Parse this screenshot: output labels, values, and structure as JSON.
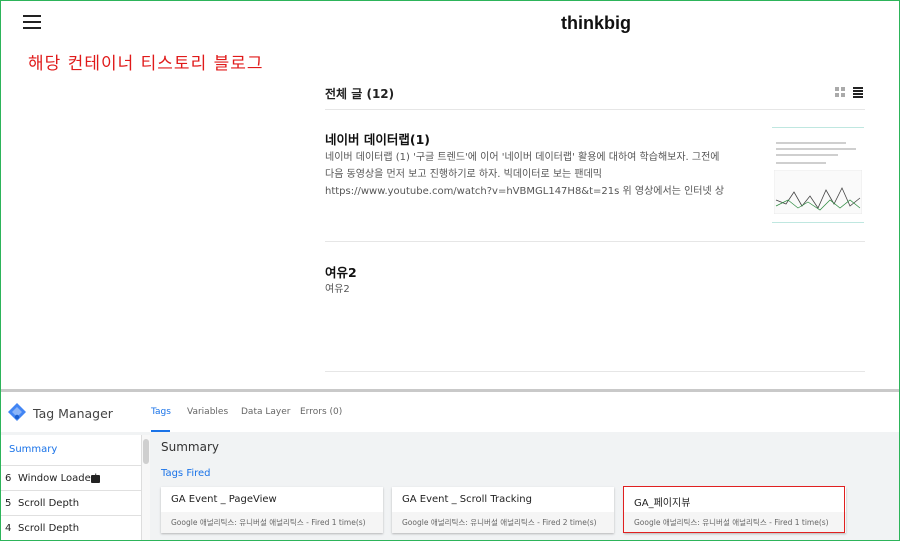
{
  "blog": {
    "site_title": "thinkbig",
    "annotation": "해당 컨테이너 티스토리 블로그",
    "list_header": "전체 글 (12)",
    "posts": [
      {
        "title": "네이버 데이터랩(1)",
        "excerpt": "네이버 데이터랩 (1) '구글 트렌드'에 이어 '네이버 데이터랩' 활용에 대하여 학습해보자. 그전에 다음 동영상을 먼저 보고 진행하기로 하자. 빅데이터로 보는 팬데믹 https://www.youtube.com/watch?v=hVBMGL147H8&t=21s 위 영상에서는 인터넷 상의 '언급량'을 기반으로 이야기를 풀어가고 있으…"
      },
      {
        "title": "여유2",
        "excerpt": "여유2"
      }
    ]
  },
  "gtm": {
    "app_name": "Tag Manager",
    "tabs": [
      "Tags",
      "Variables",
      "Data Layer",
      "Errors (0)"
    ],
    "active_tab": "Tags",
    "left_summary": "Summary",
    "events": [
      {
        "num": "6",
        "name": "Window Loaded"
      },
      {
        "num": "5",
        "name": "Scroll Depth"
      },
      {
        "num": "4",
        "name": "Scroll Depth"
      }
    ],
    "summary_title": "Summary",
    "tags_fired_label": "Tags Fired",
    "tag_cards": [
      {
        "title": "GA Event _ PageView",
        "subtitle": "Google 애널리틱스: 유니버설 애널리틱스 - Fired 1 time(s)"
      },
      {
        "title": "GA Event _ Scroll Tracking",
        "subtitle": "Google 애널리틱스: 유니버설 애널리틱스 - Fired 2 time(s)"
      },
      {
        "title": "GA_페이지뷰",
        "subtitle": "Google 애널리틱스: 유니버설 애널리틱스 - Fired 1 time(s)"
      }
    ]
  },
  "colors": {
    "annotation_red": "#e01a1a",
    "gtm_blue": "#1a73e8",
    "frame_green": "#2db45a",
    "highlight_red": "#e02020"
  }
}
